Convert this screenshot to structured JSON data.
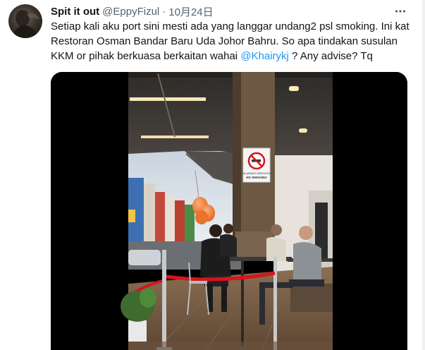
{
  "tweet": {
    "display_name": "Spit it out",
    "handle": "@EppyFizul",
    "separator": "·",
    "time": "10月24日",
    "text_before": "Setiap kali aku port sini mesti ada yang langgar undang2 psl smoking. Ini kat Restoran Osman Bandar Baru Uda Johor Bahru. So apa tindakan susulan KKM or pihak berkuasa berkaitan wahai ",
    "mention": "@Khairykj",
    "text_after": " ? Any advise? Tq"
  },
  "photo": {
    "sign_text_line1": "DILARANG MEROKOK",
    "sign_text_line2": "NO SMOKING"
  },
  "colors": {
    "text": "#0f1419",
    "secondary": "#536471",
    "link": "#1d9bf0",
    "balloon": "#f07a2a",
    "rope": "#d8141c"
  },
  "icons": {
    "more": "more-horizontal-icon",
    "no_smoking": "no-smoking-icon"
  }
}
